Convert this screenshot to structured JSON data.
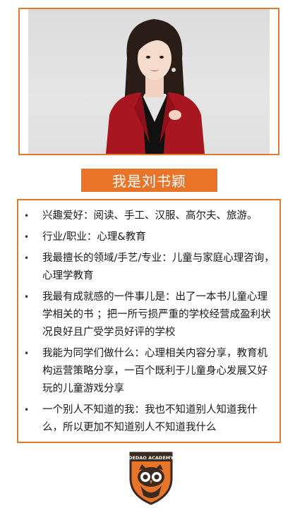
{
  "profile": {
    "name_title": "我是刘书颖"
  },
  "info_items": [
    {
      "text": "兴趣爱好：阅读、手工、汉服、高尔夫、旅游。"
    },
    {
      "text": "行业/职业：心理&教育"
    },
    {
      "text": "我最擅长的领域/手艺/专业：儿童与家庭心理咨询，心理学教育"
    },
    {
      "text": "我最有成就感的一件事儿是：出了一本书儿童心理学相关的书 ；把一所亏损严重的学校经营成盈利状况良好且广受学员好评的学校"
    },
    {
      "text": "我能为同学们做什么：心理相关内容分享，教育机构运营策略分享，一百个既利于儿童身心发展又好玩的儿童游戏分享"
    },
    {
      "text": "一个别人不知道的我：我也不知道别人知道我什么，所以更加不知道别人不知道我什么"
    }
  ],
  "logo": {
    "text": "DEDAO ACADEMY",
    "icon": "owl-icon",
    "color_primary": "#e8742a",
    "color_dark": "#3a2a20"
  },
  "colors": {
    "accent": "#e8742a",
    "blazer": "#a8161f"
  }
}
